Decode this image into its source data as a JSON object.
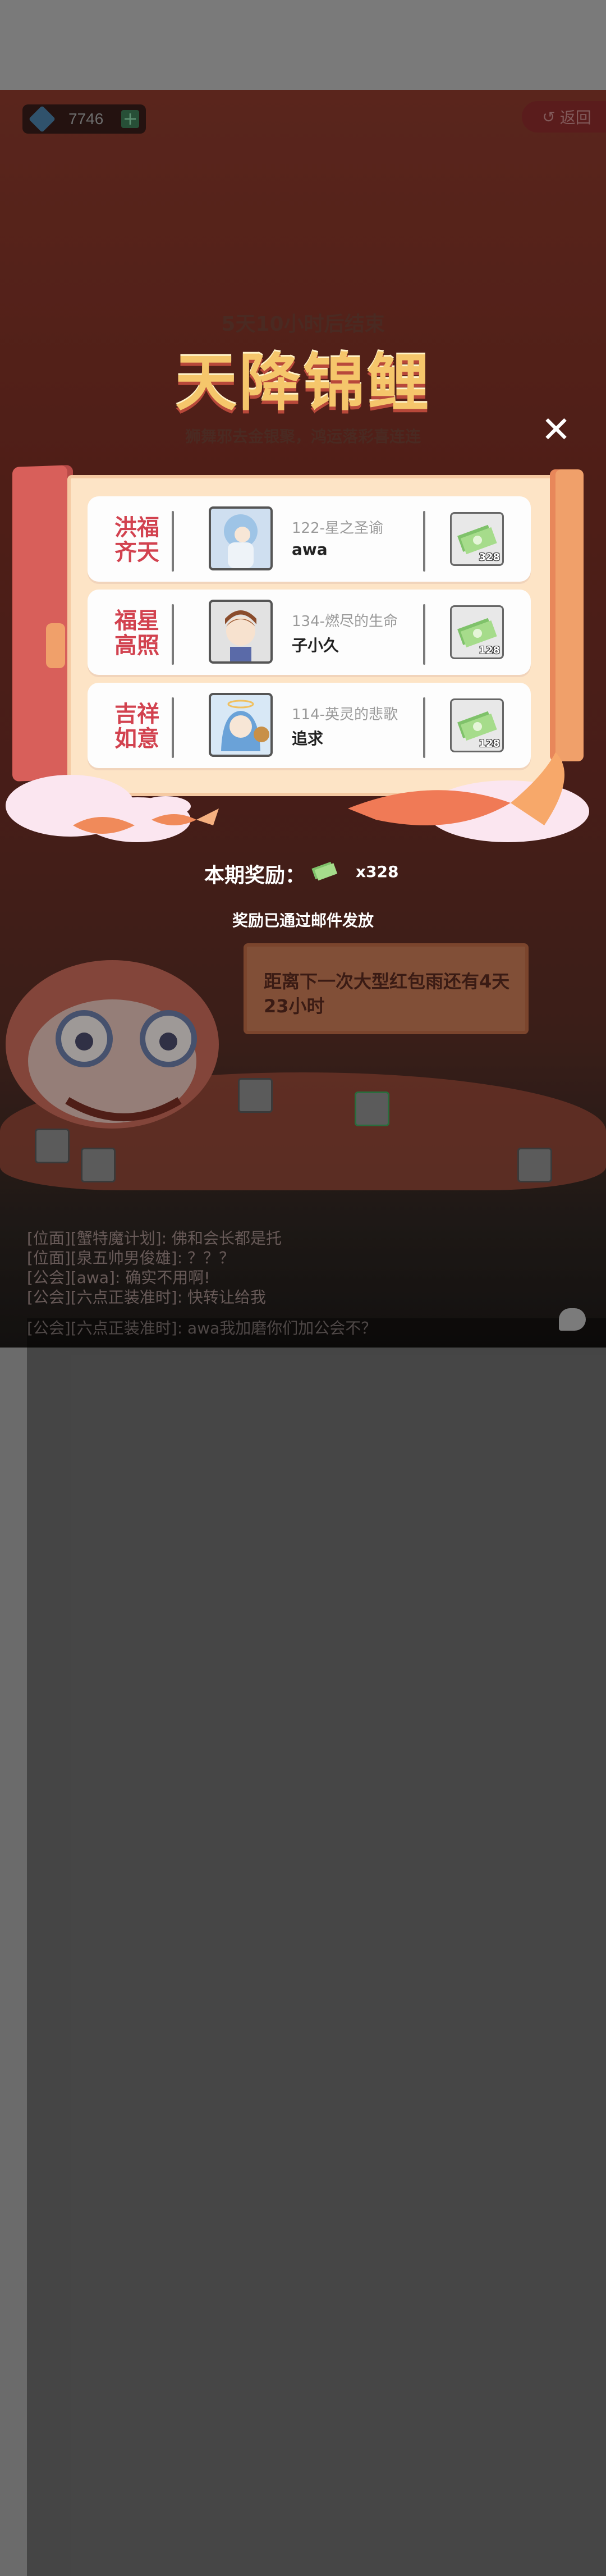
{
  "header": {
    "gem_count": "7746",
    "add_label": "+",
    "back_label": "返回"
  },
  "event": {
    "countdown": "5天10小时后结束",
    "title": "天降锦鲤",
    "slogan": "狮舞邪去金银聚，鸿运落彩喜连连"
  },
  "close_label": "✕",
  "ranks": [
    {
      "title_line1": "洪福",
      "title_line2": "齐天",
      "server": "122-星之圣谕",
      "player": "awa",
      "reward_count": "328"
    },
    {
      "title_line1": "福星",
      "title_line2": "高照",
      "server": "134-燃尽的生命",
      "player": "子小久",
      "reward_count": "128"
    },
    {
      "title_line1": "吉祥",
      "title_line2": "如意",
      "server": "114-英灵的悲歌",
      "player": "追求",
      "reward_count": "128"
    }
  ],
  "period_reward": {
    "label": "本期奖励：",
    "amount": "x328"
  },
  "mail_note": "奖励已通过邮件发放",
  "redpacket_note": "距离下一次大型红包雨还有4天23小时",
  "chat": [
    "[公会][六点正装准时]: awa我加磨你们加公会不？",
    "[位面][蟹特魔计划]: 佛和会长都是托",
    "[位面][泉五帅男俊雄]: ？？？",
    "[公会][awa]: 确实不用啊!",
    "[公会][六点正装准时]: 快转让给我"
  ],
  "colors": {
    "accent_red": "#d2424f",
    "title_gold": "#f5c66b",
    "scroll_paper": "#fde4c6"
  }
}
